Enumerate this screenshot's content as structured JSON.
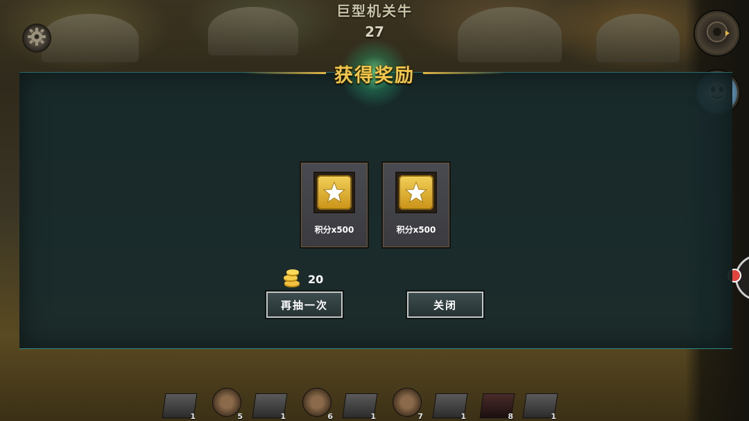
{
  "hud": {
    "level_title": "巨型机关牛",
    "level_count": "27"
  },
  "dialog": {
    "title": "获得奖励",
    "rewards": [
      {
        "icon": "star-icon",
        "label": "积分x500"
      },
      {
        "icon": "star-icon",
        "label": "积分x500"
      }
    ],
    "cost": {
      "icon": "gold-coins-icon",
      "amount": "20"
    },
    "draw_again_label": "再抽一次",
    "close_label": "关闭"
  },
  "unit_bar": [
    {
      "type": "soldier",
      "count": "1"
    },
    {
      "type": "hero",
      "count": "5"
    },
    {
      "type": "soldier",
      "count": "1"
    },
    {
      "type": "hero",
      "count": "6"
    },
    {
      "type": "soldier",
      "count": "1"
    },
    {
      "type": "hero",
      "count": "7"
    },
    {
      "type": "soldier",
      "count": "1"
    },
    {
      "type": "siege",
      "count": "8"
    },
    {
      "type": "soldier",
      "count": "1"
    }
  ],
  "colors": {
    "title_gold": "#f2c64a",
    "dialog_bg": "#182a2c",
    "card_bg": "#3a3a40",
    "button_bg": "#263234",
    "alert_dot": "#e2453d"
  }
}
